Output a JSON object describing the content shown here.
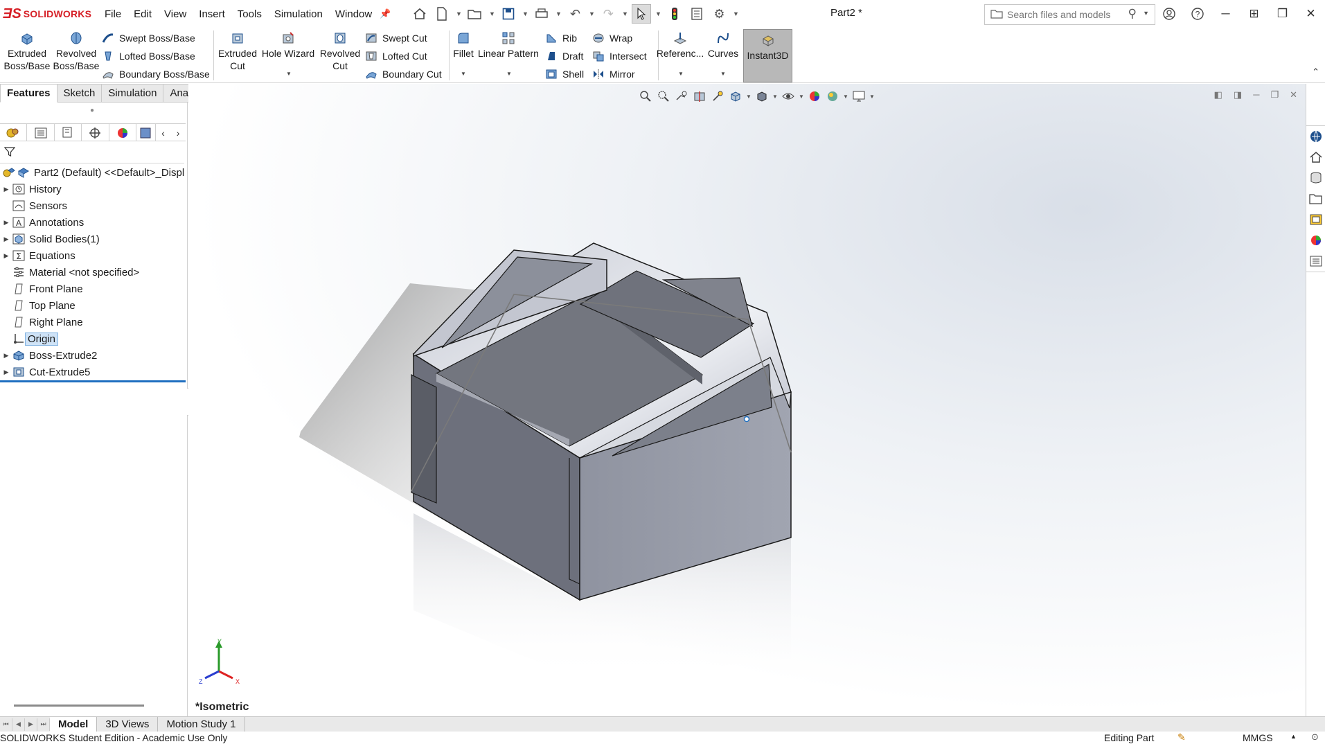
{
  "app": {
    "brand": "SOLIDWORKS",
    "document_title": "Part2 *",
    "menus": [
      "File",
      "Edit",
      "View",
      "Insert",
      "Tools",
      "Simulation",
      "Window"
    ]
  },
  "search": {
    "placeholder": "Search files and models"
  },
  "command_manager": {
    "extruded_boss": "Extruded Boss/Base",
    "revolved_boss": "Revolved Boss/Base",
    "swept_boss": "Swept Boss/Base",
    "lofted_boss": "Lofted Boss/Base",
    "boundary_boss": "Boundary Boss/Base",
    "extruded_cut": "Extruded Cut",
    "hole_wizard": "Hole Wizard",
    "revolved_cut": "Revolved Cut",
    "swept_cut": "Swept Cut",
    "lofted_cut": "Lofted Cut",
    "boundary_cut": "Boundary Cut",
    "fillet": "Fillet",
    "linear_pattern": "Linear Pattern",
    "rib": "Rib",
    "draft": "Draft",
    "shell": "Shell",
    "wrap": "Wrap",
    "intersect": "Intersect",
    "mirror": "Mirror",
    "reference": "Referenc...",
    "curves": "Curves",
    "instant3d": "Instant3D"
  },
  "cm_tabs": [
    "Features",
    "Sketch",
    "Simulation",
    "Analysis Preparation"
  ],
  "feature_tree": {
    "root": "Part2 (Default) <<Default>_Displ",
    "items": [
      {
        "label": "History",
        "expandable": true,
        "icon": "history-icon"
      },
      {
        "label": "Sensors",
        "expandable": false,
        "icon": "sensors-icon"
      },
      {
        "label": "Annotations",
        "expandable": true,
        "icon": "annotations-icon"
      },
      {
        "label": "Solid Bodies(1)",
        "expandable": true,
        "icon": "solid-bodies-icon"
      },
      {
        "label": "Equations",
        "expandable": true,
        "icon": "equations-icon"
      },
      {
        "label": "Material <not specified>",
        "expandable": false,
        "icon": "material-icon"
      },
      {
        "label": "Front Plane",
        "expandable": false,
        "icon": "plane-icon"
      },
      {
        "label": "Top Plane",
        "expandable": false,
        "icon": "plane-icon"
      },
      {
        "label": "Right Plane",
        "expandable": false,
        "icon": "plane-icon"
      },
      {
        "label": "Origin",
        "expandable": false,
        "icon": "origin-icon",
        "selected": true
      },
      {
        "label": "Boss-Extrude2",
        "expandable": true,
        "icon": "boss-extrude-icon"
      },
      {
        "label": "Cut-Extrude5",
        "expandable": true,
        "icon": "cut-extrude-icon"
      }
    ]
  },
  "viewport": {
    "view_name": "*Isometric",
    "triad_axes": [
      "Y",
      "Z",
      "X"
    ]
  },
  "bottom_tabs": [
    "Model",
    "3D Views",
    "Motion Study 1"
  ],
  "status": {
    "left": "SOLIDWORKS Student Edition - Academic Use Only",
    "editing": "Editing Part",
    "units": "MMGS"
  },
  "colors": {
    "brand_red": "#d61f26",
    "selection_blue": "#1f6fc0",
    "model_gray": "#9a9eaa"
  }
}
